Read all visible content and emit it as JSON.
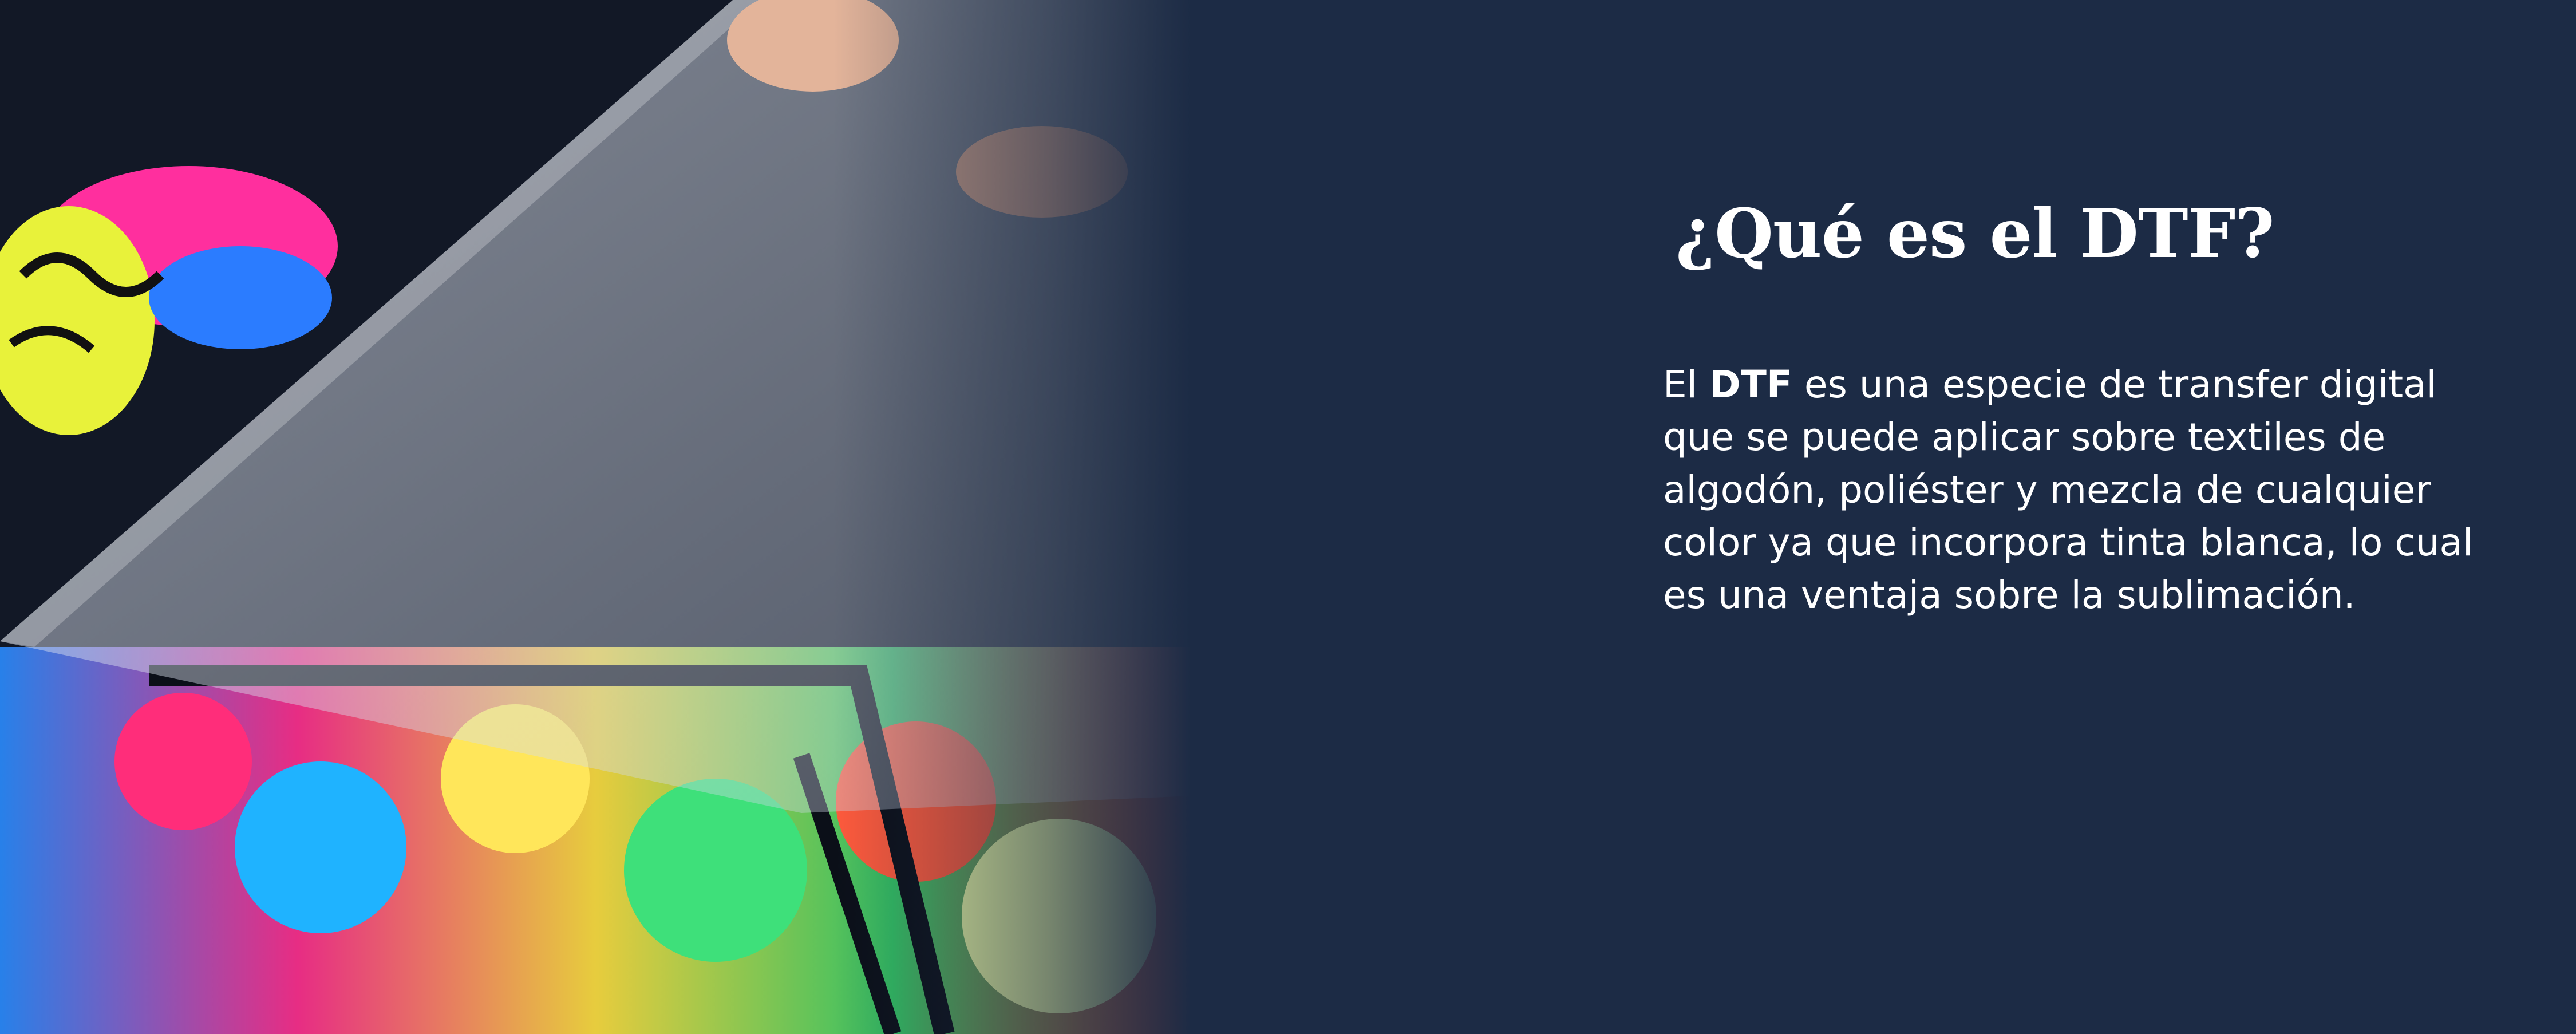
{
  "hero": {
    "title": "¿Qué es el DTF?",
    "description_prefix": "El ",
    "description_bold": "DTF",
    "description_rest": " es una especie de transfer digital que se puede aplicar sobre textiles de algodón, poliéster y mezcla de cualquier color ya que incorpora tinta blanca, lo cual es una ventaja sobre la sublimación."
  },
  "colors": {
    "background": "#1c2b45",
    "text": "#ffffff"
  }
}
